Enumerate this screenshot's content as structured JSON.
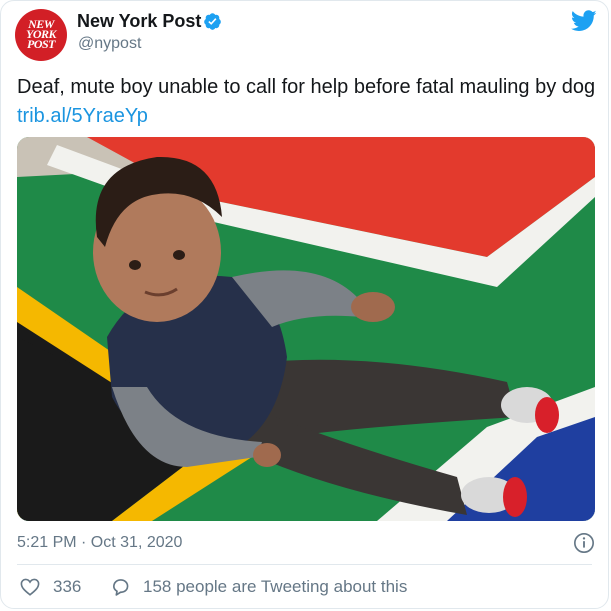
{
  "account": {
    "display_name": "New York Post",
    "handle": "@nypost",
    "logo_lines": [
      "NEW",
      "YORK",
      "POST"
    ],
    "verified": true
  },
  "tweet": {
    "text": "Deaf, mute boy unable to call for help before fatal mauling by dog ",
    "link": "trib.al/5YraeYp",
    "timestamp": "5:21 PM · Oct 31, 2020"
  },
  "engagement": {
    "likes": "336",
    "conversation": "158 people are Tweeting about this"
  },
  "colors": {
    "link": "#1b95e0",
    "secondary_text": "#657786",
    "brand_red": "#d21f26",
    "twitter_blue": "#1da1f2"
  },
  "icons": [
    "twitter-bird-icon",
    "verified-badge-icon",
    "info-icon",
    "heart-icon",
    "reply-bubble-icon"
  ]
}
